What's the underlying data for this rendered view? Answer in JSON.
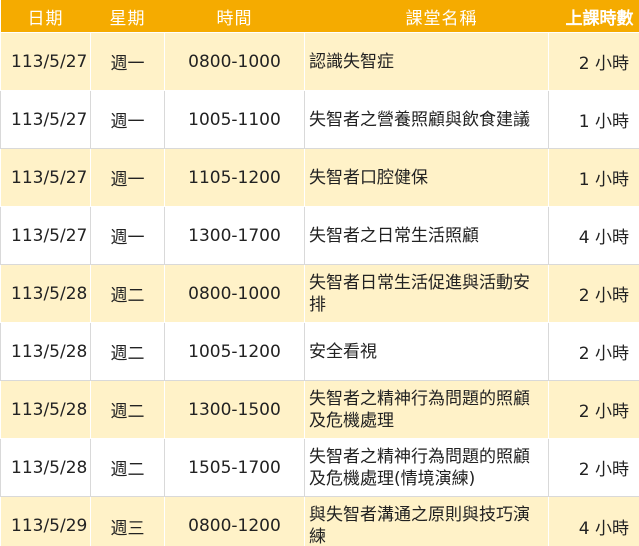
{
  "headers": {
    "date": "日期",
    "day": "星期",
    "time": "時間",
    "course": "課堂名稱",
    "hours": "上課時數"
  },
  "colors": {
    "header_bg": "#f5ab00",
    "header_text": "#ffffff",
    "alt_row_bg": "#fff2c8",
    "plain_row_bg": "#ffffff"
  },
  "rows": [
    {
      "date": "113/5/27",
      "day": "週一",
      "time": "0800-1000",
      "course": "認識失智症",
      "hours": "2 小時"
    },
    {
      "date": "113/5/27",
      "day": "週一",
      "time": "1005-1100",
      "course": "失智者之營養照顧與飲食建議",
      "hours": "1 小時"
    },
    {
      "date": "113/5/27",
      "day": "週一",
      "time": "1105-1200",
      "course": "失智者口腔健保",
      "hours": "1 小時"
    },
    {
      "date": "113/5/27",
      "day": "週一",
      "time": "1300-1700",
      "course": "失智者之日常生活照顧",
      "hours": "4 小時"
    },
    {
      "date": "113/5/28",
      "day": "週二",
      "time": "0800-1000",
      "course": "失智者日常生活促進與活動安排",
      "hours": "2 小時"
    },
    {
      "date": "113/5/28",
      "day": "週二",
      "time": "1005-1200",
      "course": "安全看視",
      "hours": "2 小時"
    },
    {
      "date": "113/5/28",
      "day": "週二",
      "time": "1300-1500",
      "course": "失智者之精神行為問題的照顧及危機處理",
      "hours": "2 小時"
    },
    {
      "date": "113/5/28",
      "day": "週二",
      "time": "1505-1700",
      "course": "失智者之精神行為問題的照顧及危機處理(情境演練)",
      "hours": "2 小時"
    },
    {
      "date": "113/5/29",
      "day": "週三",
      "time": "0800-1200",
      "course": "與失智者溝通之原則與技巧演練",
      "hours": "4 小時"
    }
  ]
}
